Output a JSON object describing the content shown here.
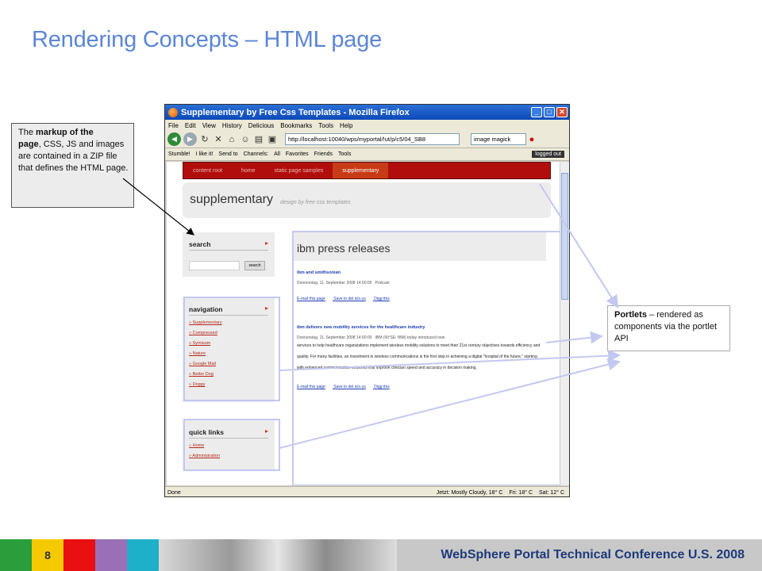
{
  "slide": {
    "title": "Rendering Concepts – HTML page",
    "callout_left": {
      "pre": "The ",
      "bold1": "markup of the",
      "bold2": "page",
      "rest": ", CSS, JS and images are contained in a ZIP file that defines the HTML page."
    },
    "callout_right": {
      "bold": "Portlets",
      "rest": " – rendered as components via the portlet API"
    },
    "footer": {
      "page_number": "8",
      "conference": "WebSphere Portal Technical Conference U.S. 2008"
    }
  },
  "browser": {
    "window_title": "Supplementary by Free Css Templates - Mozilla Firefox",
    "menu": [
      "File",
      "Edit",
      "View",
      "History",
      "Delicious",
      "Bookmarks",
      "Tools",
      "Help"
    ],
    "url": "http://localhost:10040/wps/myportal/!ut/p/c5/04_SB8",
    "search_value": "image magick",
    "toolbar2": [
      "Stumble!",
      "I like it!",
      "Send to",
      "Channels:",
      "All",
      "Favorites",
      "Friends",
      "Tools"
    ],
    "logged_out": "logged out",
    "status": {
      "done": "Done",
      "weather_now": "Jetzt: Mostly Cloudy, 18° C",
      "fri": "Fri: 18° C",
      "sat": "Sat: 12° C"
    }
  },
  "site": {
    "menu": [
      "content root",
      "home",
      "static page samples",
      "supplementary"
    ],
    "active_menu": "supplementary",
    "name": "supplementary",
    "subtitle": "design by free css templates",
    "search": {
      "heading": "search",
      "button": "search"
    },
    "navigation": {
      "heading": "navigation",
      "items": [
        "Supplementary",
        "Compressed",
        "Symisum",
        "Nature",
        "Google Mail",
        "Better Dog",
        "Doggy"
      ]
    },
    "quick_links": {
      "heading": "quick links",
      "items": [
        "Home",
        "Administration"
      ]
    },
    "main": {
      "heading": "ibm press releases",
      "articles": [
        {
          "title": "ibm and smithsonian",
          "date": "Donnerstag, 11. September 2008 14:00:00",
          "tag": "Podcast",
          "body": "",
          "links": [
            "E-mail this page",
            "Save to del.icio.us",
            "Digg this"
          ]
        },
        {
          "title": "ibm delivers new mobility services for the healthcare industry",
          "date": "Donnerstag, 11. September 2008 14:00:00",
          "tag": "IBM (NYSE: IBM) today introduced new",
          "body": "services to help healthcare organizations implement wireless mobility solutions to meet their 21st century objectives towards efficiency and quality. For many facilities, an investment in wireless communications is the first step in achieving a digital \"hospital of the future,\" starting with enhanced communication networks that improve clinician speed and accuracy in decision making.",
          "links": [
            "E-mail this page",
            "Save to del.icio.us",
            "Digg this"
          ]
        }
      ]
    }
  },
  "colors": {
    "title_blue": "#5b86d6",
    "menu_red": "#b10d0d",
    "link_blue": "#1d3cb3",
    "highlight": "#c4c8f0",
    "footer_yellow": "#f5c900"
  }
}
